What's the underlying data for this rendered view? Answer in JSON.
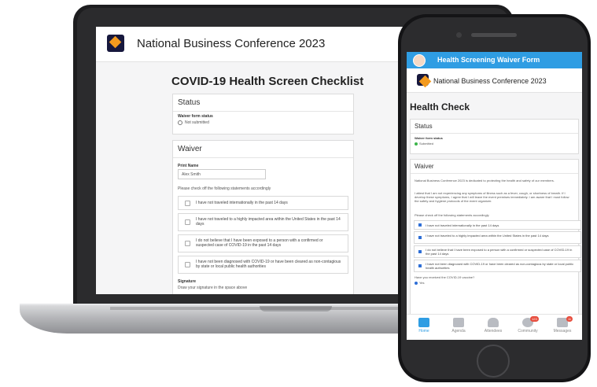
{
  "laptop": {
    "header_title": "National Business Conference 2023",
    "page_title": "COVID-19 Health Screen Checklist",
    "status_card": {
      "heading": "Status",
      "field_label": "Waiver form status",
      "field_value": "Not submitted"
    },
    "waiver_card": {
      "heading": "Waiver",
      "print_name_label": "Print Name",
      "print_name_value": "Alex Smith",
      "instruction": "Please check off the following statements accordingly",
      "statements": [
        "I have not traveled internationally in the past 14 days",
        "I have not traveled to a highly impacted area within the United States in the past 14 days",
        "I do not believe that I have been exposed to a person with a confirmed or suspected case of COVID-19 in the past 14 days",
        "I have not been diagnosed with COVID-19 or have been cleared as non-contagious by state or local public health authorities"
      ],
      "signature_label": "Signature",
      "signature_hint": "Draw your signature in the space above"
    }
  },
  "phone": {
    "top_bar_title": "Health Screening Waiver Form",
    "header_title": "National Business Conference 2023",
    "page_title": "Health Check",
    "status_card": {
      "heading": "Status",
      "field_label": "Waiver form status",
      "field_value": "Submitted",
      "status_color": "#3cb54a"
    },
    "waiver_card": {
      "heading": "Waiver",
      "para1": "National Business Conference 2023 is dedicated to protecting the health and safety of our members.",
      "para2": "I attest that I am not experiencing any symptoms of illness such as a fever, cough, or shortness of breath. If I develop these symptoms, I agree that I will leave the event premises immediately. I am aware that I must follow the safety and hygiene protocols of the event organizer.",
      "instruction": "Please check off the following statements accordingly",
      "statements": [
        "I have not traveled internationally in the past 14 days",
        "I have not traveled to a highly impacted area within the United States in the past 14 days",
        "I do not believe that I have been exposed to a person with a confirmed or suspected case of COVID-19 in the past 14 days",
        "I have not been diagnosed with COVID-19 or have been cleared as non-contagious by state or local public health authorities"
      ],
      "vaccine_question": "Have you received the COVID-19 vaccine?",
      "vaccine_answer": "Yes"
    },
    "tabs": [
      {
        "label": "Home",
        "icon": "home-icon"
      },
      {
        "label": "Agenda",
        "icon": "calendar-icon"
      },
      {
        "label": "Attendees",
        "icon": "people-icon"
      },
      {
        "label": "Community",
        "icon": "chat-icon",
        "badge": "123"
      },
      {
        "label": "Messages",
        "icon": "mail-icon",
        "badge": "11"
      }
    ],
    "accent_color": "#2f9de3"
  }
}
